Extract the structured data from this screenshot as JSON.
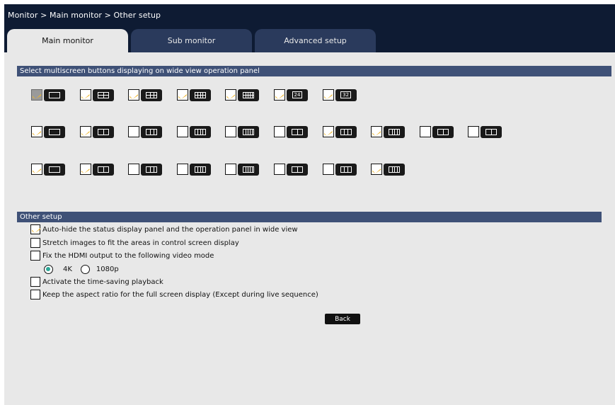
{
  "breadcrumb": "Monitor > Main monitor > Other setup",
  "tabs": [
    {
      "label": "Main monitor",
      "active": true
    },
    {
      "label": "Sub monitor",
      "active": false
    },
    {
      "label": "Advanced setup",
      "active": false
    }
  ],
  "multiscreen": {
    "heading": "Select multiscreen buttons displaying on wide view operation panel",
    "rows": [
      [
        {
          "icon": "single-screen-icon",
          "checked": true,
          "disabled": true
        },
        {
          "icon": "quad-screen-icon",
          "checked": true
        },
        {
          "icon": "nine-screen-icon",
          "checked": true
        },
        {
          "icon": "twelve-screen-icon",
          "checked": true
        },
        {
          "icon": "sixteen-screen-icon",
          "checked": true
        },
        {
          "icon": "twentyfour-screen-icon",
          "checked": true,
          "number": "24"
        },
        {
          "icon": "thirtytwo-screen-icon",
          "checked": true,
          "number": "32"
        }
      ],
      [
        {
          "icon": "wide-single-icon",
          "checked": true
        },
        {
          "icon": "wide-quad-icon",
          "checked": true
        },
        {
          "icon": "wide-nine-icon",
          "checked": false
        },
        {
          "icon": "wide-twelve-icon",
          "checked": false
        },
        {
          "icon": "wide-sixteen-icon",
          "checked": false
        },
        {
          "icon": "wide-split-icon",
          "checked": false
        },
        {
          "icon": "wide-grid-icon",
          "checked": true
        },
        {
          "icon": "wide-multi-icon",
          "checked": true
        },
        {
          "icon": "wide-side-icon",
          "checked": false
        },
        {
          "icon": "wide-side2-icon",
          "checked": false
        }
      ],
      [
        {
          "icon": "two-split-icon",
          "checked": true
        },
        {
          "icon": "three-split-icon",
          "checked": true
        },
        {
          "icon": "four-split-icon",
          "checked": false
        },
        {
          "icon": "side-split-icon",
          "checked": false
        },
        {
          "icon": "side-split2-icon",
          "checked": false
        },
        {
          "icon": "center-split-icon",
          "checked": false
        },
        {
          "icon": "top-split-icon",
          "checked": false
        },
        {
          "icon": "top-split2-icon",
          "checked": true
        }
      ]
    ]
  },
  "other_setup": {
    "heading": "Other setup",
    "options": [
      {
        "label": "Auto-hide the status display panel and the operation panel in wide view",
        "checked": true
      },
      {
        "label": "Stretch images to fit the areas in control screen display",
        "checked": false
      },
      {
        "label": "Fix the HDMI output to the following video mode",
        "checked": false
      },
      {
        "label": "Activate the time-saving playback",
        "checked": false
      },
      {
        "label": "Keep the aspect ratio for the full screen display (Except during live sequence)",
        "checked": false
      }
    ],
    "video_mode": {
      "options": [
        "4K",
        "1080p"
      ],
      "selected": "4K"
    }
  },
  "back_label": "Back",
  "colors": {
    "checkbox_check": "#f0b428",
    "header_bg": "#0e1b33",
    "section_bg": "#3f5177",
    "radio_on": "#2aa897"
  }
}
